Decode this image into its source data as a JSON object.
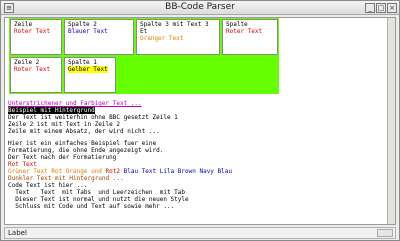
{
  "window": {
    "title": "BB-Code Parser"
  },
  "icons": {
    "menu": "window-menu-icon",
    "min": "minimize-icon",
    "max": "maximize-icon",
    "close": "close-icon"
  },
  "table": {
    "c1": {
      "line1": "Zeile",
      "line2": "Roter Text"
    },
    "c2": {
      "line1": "Spalte 2",
      "line2": "Blauer Text"
    },
    "c3": {
      "line1": "Spalte 3 mit Text 3 Et",
      "line2": "Oranger Text"
    },
    "c4": {
      "line1": "Spalte",
      "line2": "Roter Text"
    },
    "c5": {
      "line1": "Zeile 2",
      "line2": "Roter Text"
    },
    "c6": {
      "line1": "Spalte 1",
      "line2": "Gelber Text"
    }
  },
  "text": {
    "l1": "Unterstrichener und Farbiger Text ...",
    "l2": "Beispiel mit Hintergrund",
    "l3": "Der Text ist weiterhin ohne BBC gesetzt Zeile 1",
    "l4": "Zeile 2 ist mit Text in Zeile 2",
    "l5": "Zeile mit einem Absatz, der wird nicht ...",
    "l6": "Hier ist ein einfaches Beispiel fuer eine",
    "l7": "Formatierung, die ohne Ende angezeigt wird.",
    "l8": "Der Text nach der Formatierung",
    "l9": "Rot Text",
    "l10a": "Grüner Text Rot Orange und ",
    "l10b": "Rot2 ",
    "l10c": "Blau Text Lila Brown Navy Blau",
    "l11": "Dunkler Text mit Hintergrund ...",
    "l12": "Code Text ist hier ...",
    "l13": "  Text   Text  mit Tabs  und Leerzeichen  mit Tab",
    "l14": "  Dieser Text ist normal und nutzt die neuen Style",
    "l15": "  Schluss mit Code und Text auf sowie mehr ..."
  },
  "status": {
    "label": "Label"
  }
}
